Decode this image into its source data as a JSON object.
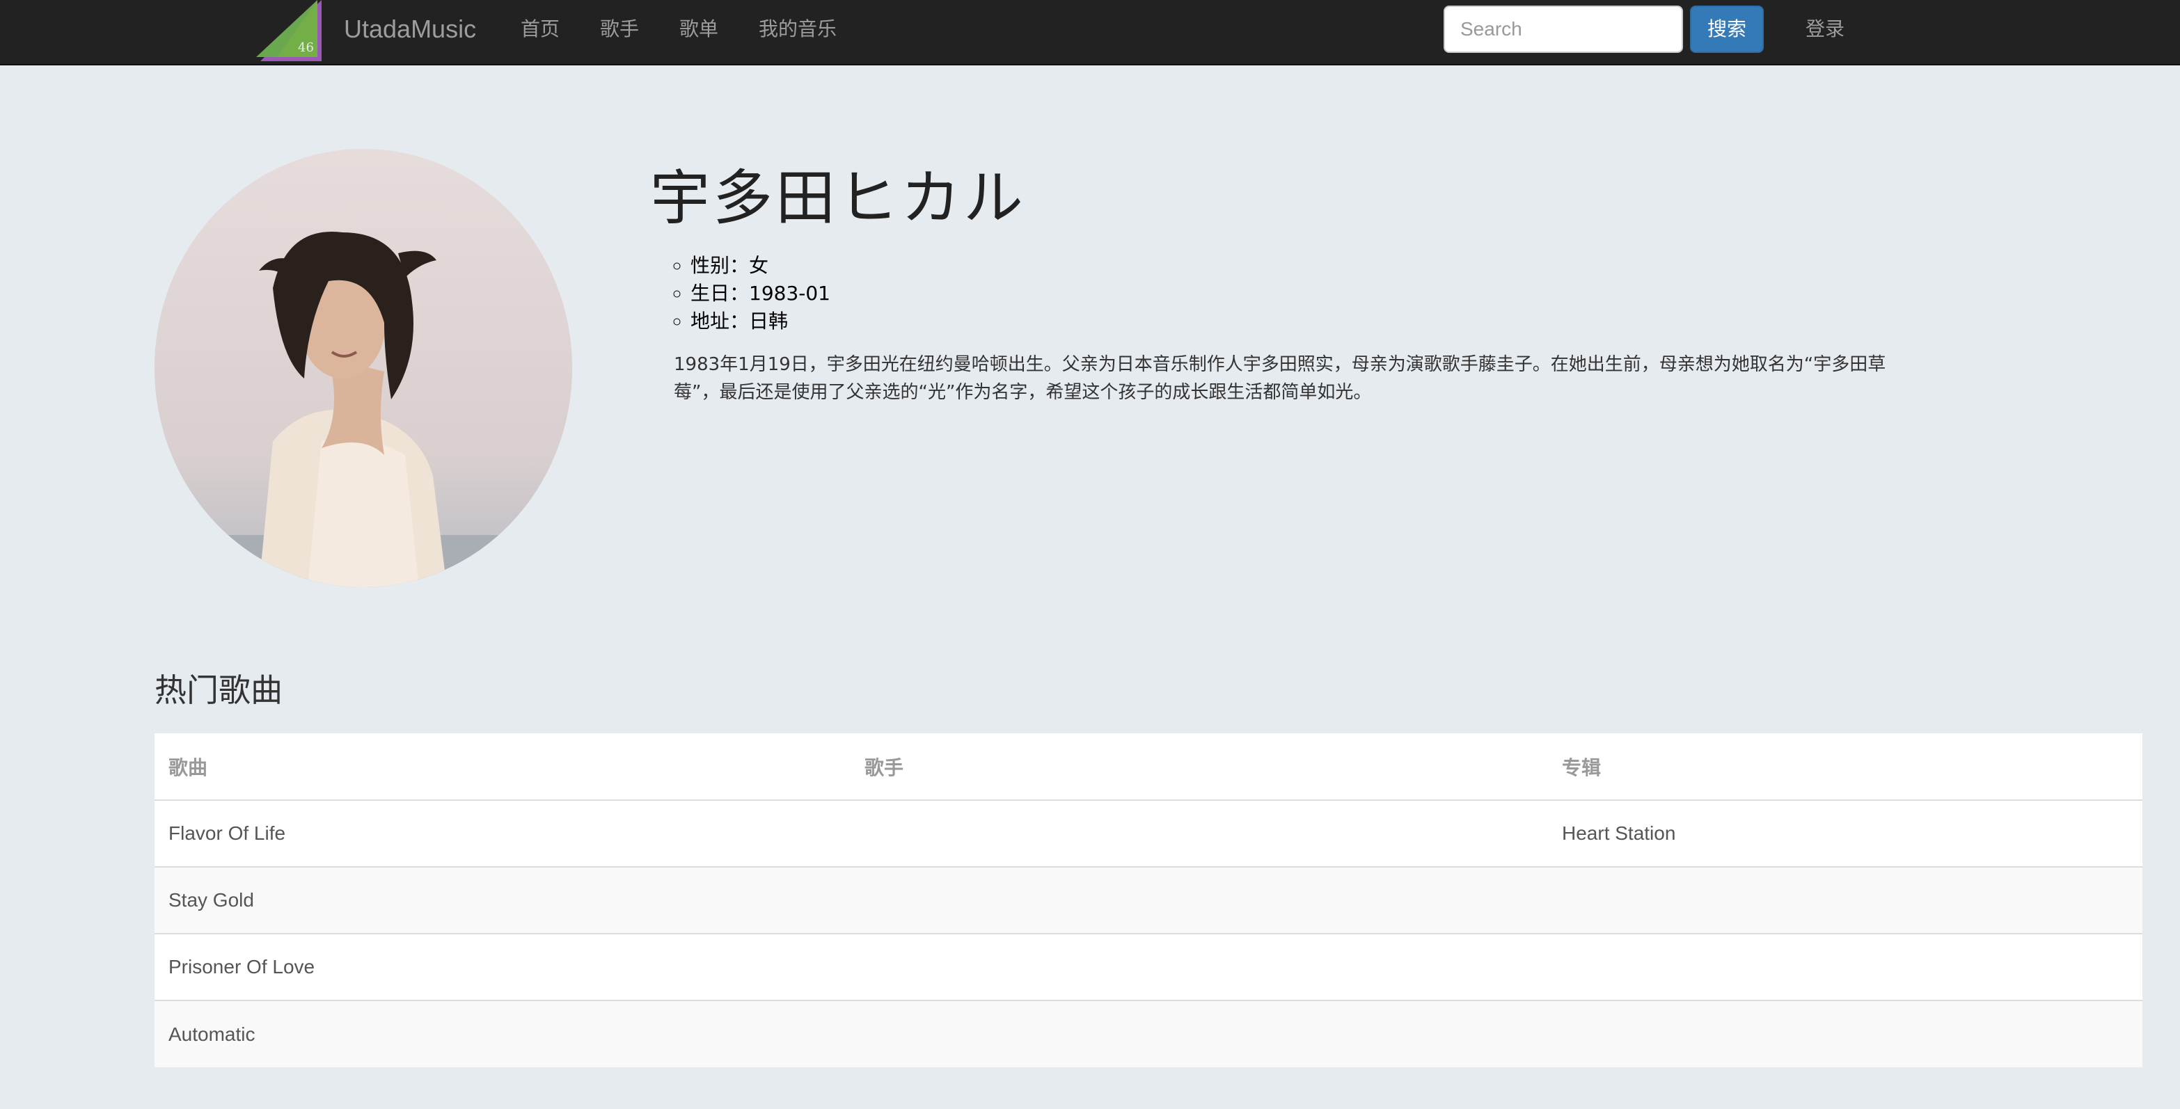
{
  "nav": {
    "brand": "UtadaMusic",
    "links": [
      "首页",
      "歌手",
      "歌单",
      "我的音乐"
    ],
    "search_placeholder": "Search",
    "search_button": "搜索",
    "login": "登录"
  },
  "artist": {
    "name": "宇多田ヒカル",
    "info": [
      "性别：女",
      "生日：1983-01",
      "地址：日韩"
    ],
    "bio": "1983年1月19日，宇多田光在纽约曼哈顿出生。父亲为日本音乐制作人宇多田照实，母亲为演歌歌手藤圭子。在她出生前，母亲想为她取名为“宇多田草莓”，最后还是使用了父亲选的“光”作为名字，希望这个孩子的成长跟生活都简单如光。"
  },
  "songs": {
    "title": "热门歌曲",
    "headers": [
      "歌曲",
      "歌手",
      "专辑"
    ],
    "rows": [
      [
        "Flavor Of Life",
        "",
        "Heart Station"
      ],
      [
        "Stay Gold",
        "",
        ""
      ],
      [
        "Prisoner Of Love",
        "",
        ""
      ],
      [
        "Automatic",
        "",
        ""
      ]
    ]
  },
  "colors": {
    "navbar": "#222222",
    "accent": "#337ab7",
    "page_bg": "#e6ebf0"
  }
}
